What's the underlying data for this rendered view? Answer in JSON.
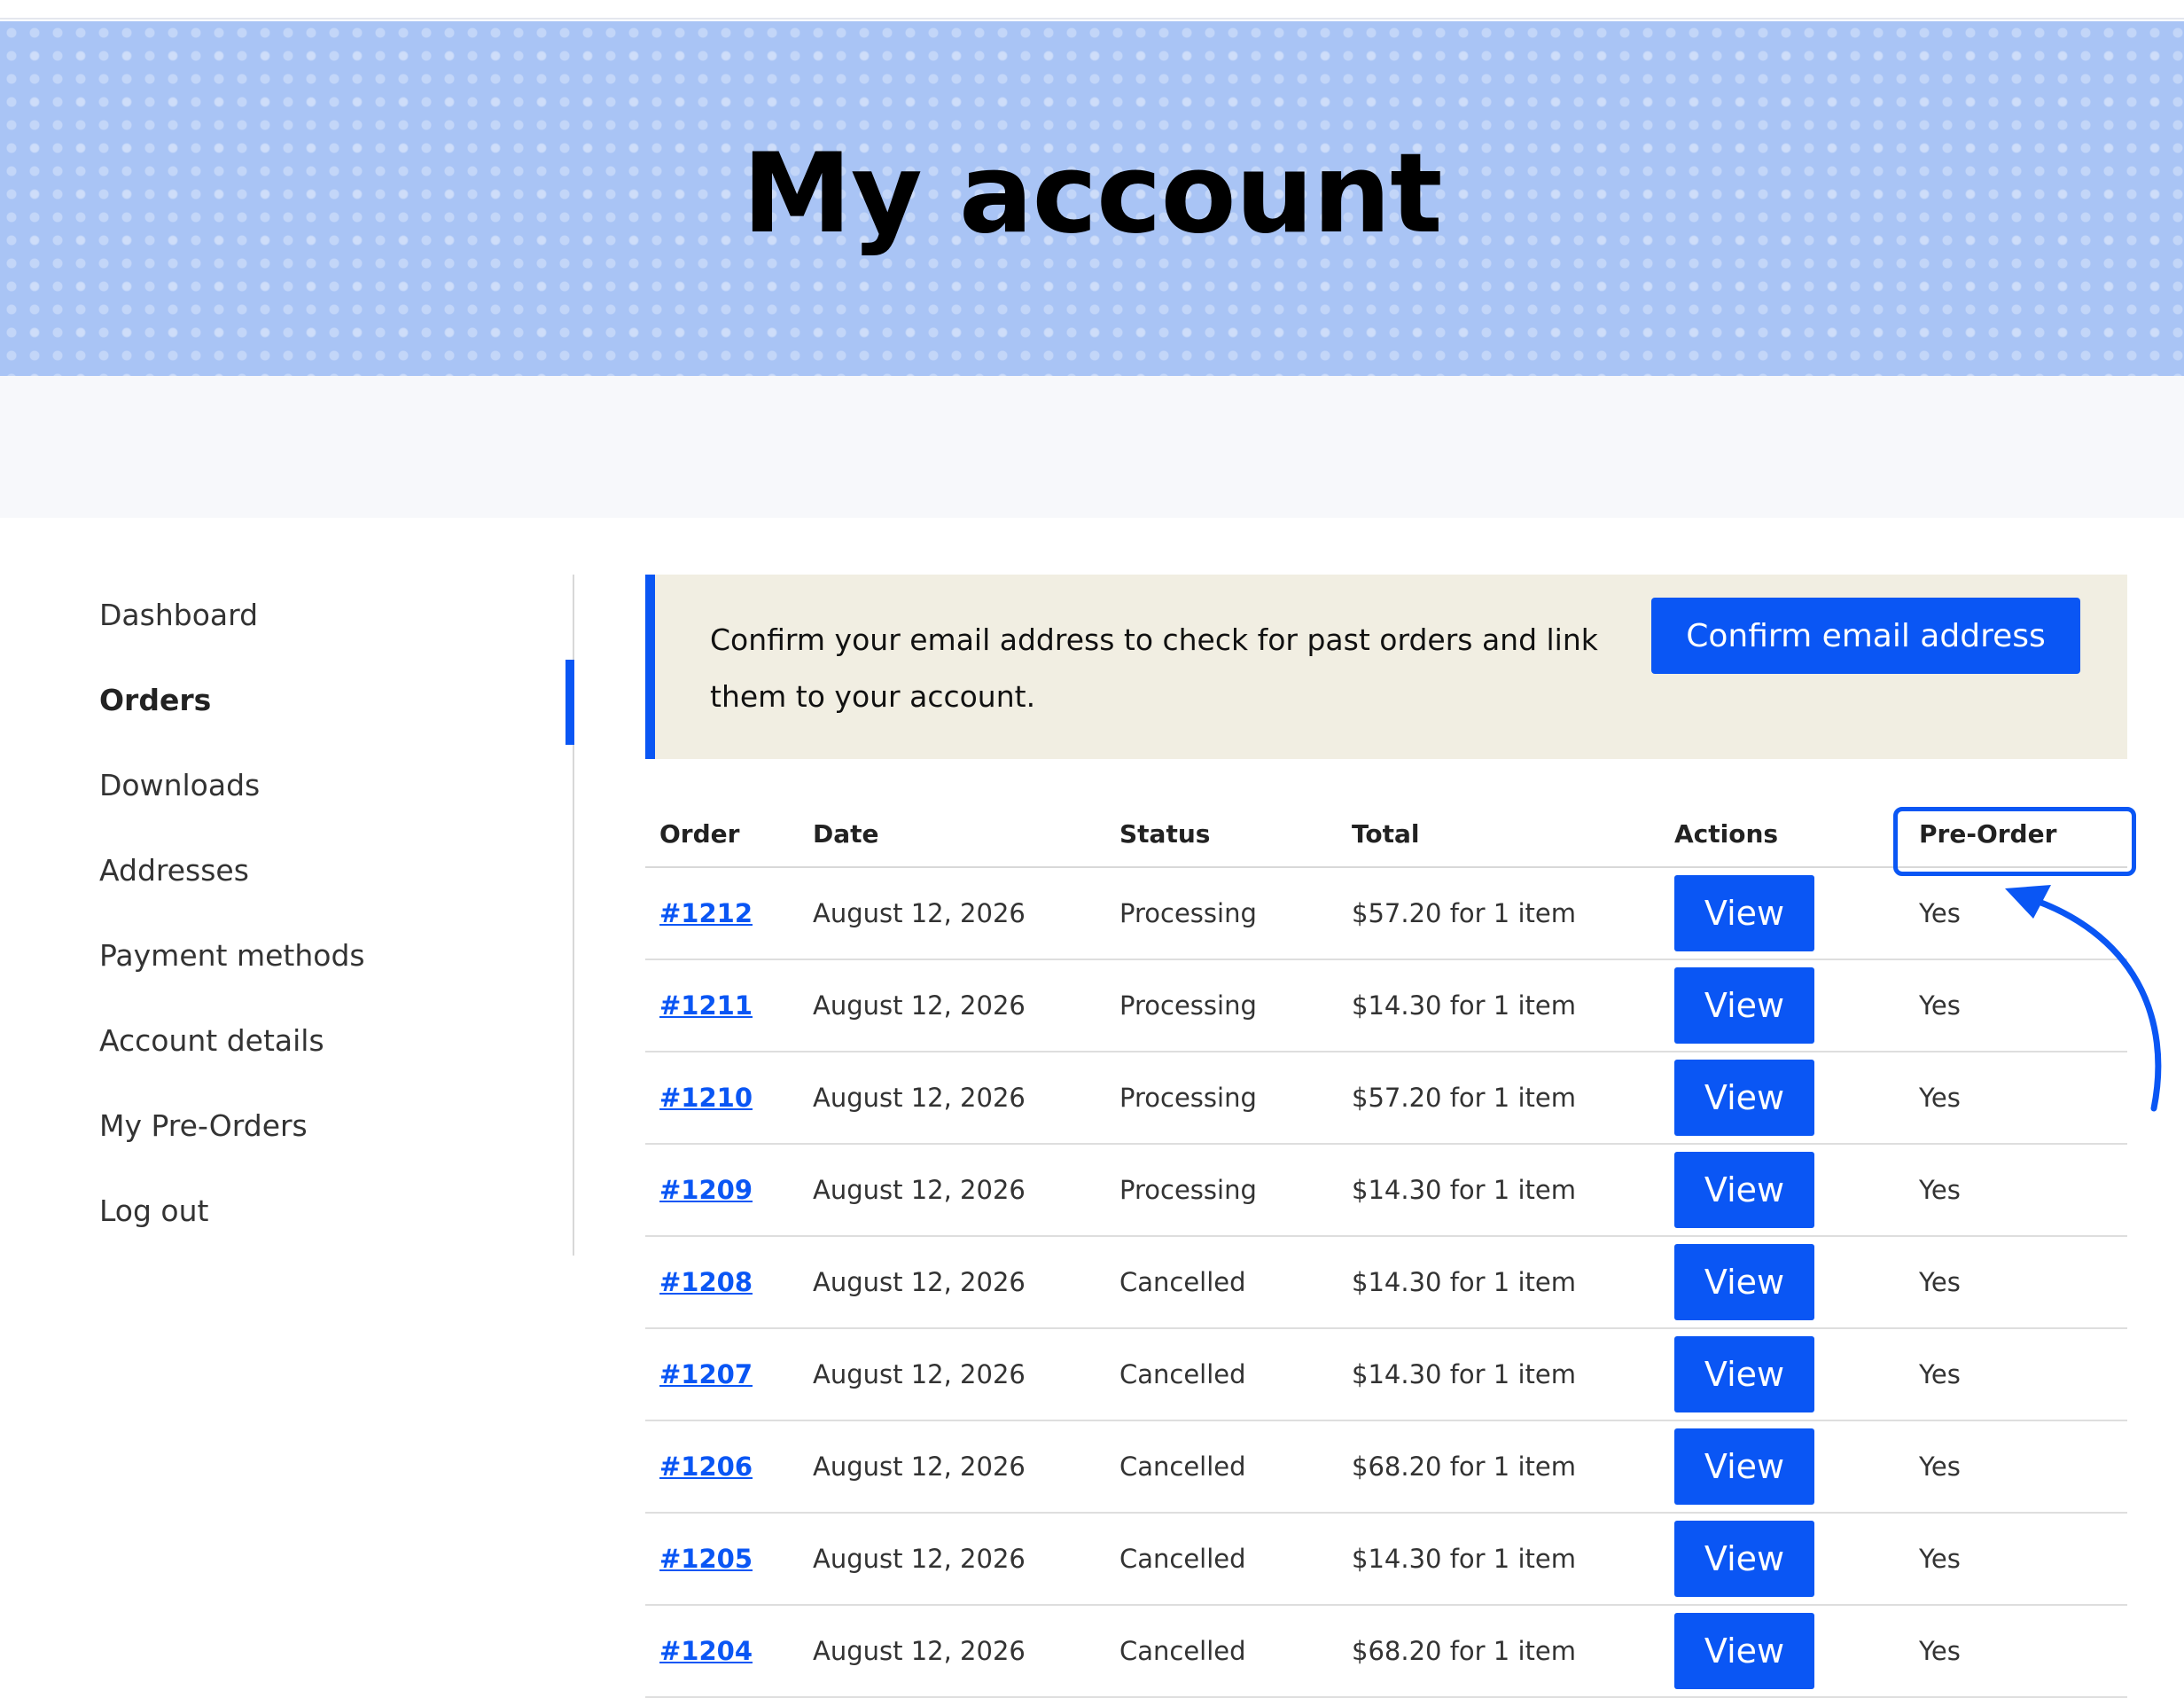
{
  "hero": {
    "title": "My account"
  },
  "sidebar": {
    "items": [
      {
        "label": "Dashboard",
        "active": false
      },
      {
        "label": "Orders",
        "active": true
      },
      {
        "label": "Downloads",
        "active": false
      },
      {
        "label": "Addresses",
        "active": false
      },
      {
        "label": "Payment methods",
        "active": false
      },
      {
        "label": "Account details",
        "active": false
      },
      {
        "label": "My Pre-Orders",
        "active": false
      },
      {
        "label": "Log out",
        "active": false
      }
    ]
  },
  "notice": {
    "text": "Confirm your email address to check for past orders and link them to your account.",
    "button_label": "Confirm email address"
  },
  "orders": {
    "columns": [
      "Order",
      "Date",
      "Status",
      "Total",
      "Actions",
      "Pre-Order"
    ],
    "view_label": "View",
    "rows": [
      {
        "order": "#1212",
        "date": "August 12, 2026",
        "status": "Processing",
        "total": "$57.20 for 1 item",
        "preorder": "Yes"
      },
      {
        "order": "#1211",
        "date": "August 12, 2026",
        "status": "Processing",
        "total": "$14.30 for 1 item",
        "preorder": "Yes"
      },
      {
        "order": "#1210",
        "date": "August 12, 2026",
        "status": "Processing",
        "total": "$57.20 for 1 item",
        "preorder": "Yes"
      },
      {
        "order": "#1209",
        "date": "August 12, 2026",
        "status": "Processing",
        "total": "$14.30 for 1 item",
        "preorder": "Yes"
      },
      {
        "order": "#1208",
        "date": "August 12, 2026",
        "status": "Cancelled",
        "total": "$14.30 for 1 item",
        "preorder": "Yes"
      },
      {
        "order": "#1207",
        "date": "August 12, 2026",
        "status": "Cancelled",
        "total": "$14.30 for 1 item",
        "preorder": "Yes"
      },
      {
        "order": "#1206",
        "date": "August 12, 2026",
        "status": "Cancelled",
        "total": "$68.20 for 1 item",
        "preorder": "Yes"
      },
      {
        "order": "#1205",
        "date": "August 12, 2026",
        "status": "Cancelled",
        "total": "$14.30 for 1 item",
        "preorder": "Yes"
      },
      {
        "order": "#1204",
        "date": "August 12, 2026",
        "status": "Cancelled",
        "total": "$68.20 for 1 item",
        "preorder": "Yes"
      }
    ]
  },
  "colors": {
    "accent": "#0a56f4",
    "hero_bg": "#a9c4f5",
    "notice_bg": "#f1eee2"
  }
}
